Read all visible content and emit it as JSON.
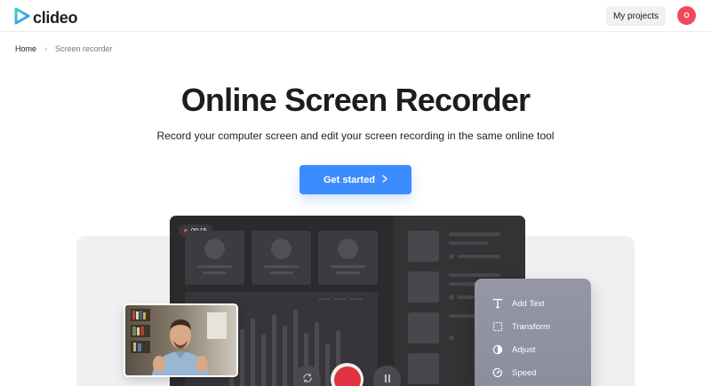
{
  "header": {
    "brand": "clideo",
    "my_projects_label": "My projects",
    "avatar_initial": "O",
    "brand_color": "#3b8cff"
  },
  "breadcrumb": {
    "home": "Home",
    "separator": "›",
    "current": "Screen recorder"
  },
  "hero": {
    "title": "Online Screen Recorder",
    "subtitle": "Record your computer screen and edit your screen recording in the same online tool",
    "cta_label": "Get started",
    "cta_icon": "chevron-right-icon",
    "cta_color": "#3b8cff"
  },
  "illustration": {
    "timer": "00:15",
    "record_color": "#e0333f",
    "controls": [
      "cycle-icon",
      "record-icon",
      "pause-icon"
    ]
  },
  "tools_panel": {
    "items": [
      {
        "label": "Add Text",
        "icon": "text-icon"
      },
      {
        "label": "Transform",
        "icon": "transform-icon"
      },
      {
        "label": "Adjust",
        "icon": "adjust-icon"
      },
      {
        "label": "Speed",
        "icon": "speed-icon"
      }
    ]
  }
}
